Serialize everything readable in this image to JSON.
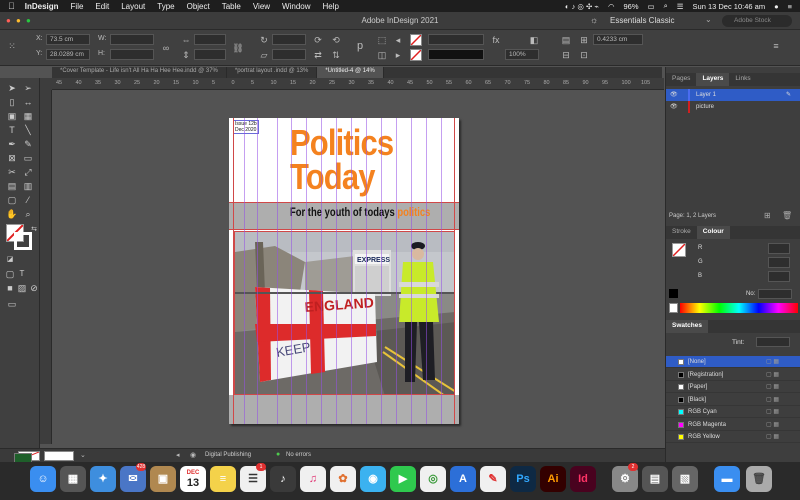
{
  "menubar": {
    "apple": "",
    "app_name": "InDesign",
    "items": [
      "File",
      "Edit",
      "Layout",
      "Type",
      "Object",
      "Table",
      "View",
      "Window",
      "Help"
    ],
    "battery": "96%",
    "datetime": "Sun 13 Dec  10:46 am"
  },
  "appbar": {
    "title": "Adobe InDesign 2021",
    "workspace": "Essentials Classic",
    "search_placeholder": "Adobe Stock"
  },
  "control": {
    "x_label": "X:",
    "x_value": "73.5 cm",
    "y_label": "Y:",
    "y_value": "28.0289 cm",
    "w_label": "W:",
    "h_label": "H:",
    "scale_x": "100%",
    "stroke_weight": "0.4233 cm",
    "zoom_pct": "100%"
  },
  "tabs": [
    "*Cover Template - Life isn't All Ha Ha Hee Hee.indd @ 37%",
    "*portrat layout .indd @ 13%",
    "*Untitled-4 @ 14%"
  ],
  "ruler": {
    "h_ticks": [
      "45",
      "40",
      "35",
      "30",
      "25",
      "20",
      "15",
      "10",
      "5",
      "0",
      "5",
      "10",
      "15",
      "20",
      "25",
      "30",
      "35",
      "40",
      "45",
      "50",
      "55",
      "60",
      "65",
      "70",
      "75",
      "80",
      "85",
      "90",
      "95",
      "100",
      "105"
    ]
  },
  "page": {
    "issue_line1": "Issue 12b",
    "issue_line2": "Dec 2020",
    "title_line1": "Politics",
    "title_line2": "Today",
    "tagline_main": "For the youth of todays ",
    "tagline_highlight": "politics",
    "photo_banner": "ENGLAND",
    "photo_banner2": "KEEP",
    "photo_sign": "EXPRESS"
  },
  "status": {
    "preflight_profile": "Digital Publishing",
    "errors": "No errors"
  },
  "layers_panel": {
    "tabs": [
      "Pages",
      "Layers",
      "Links"
    ],
    "layers": [
      {
        "name": "Layer 1",
        "color": "#4a6cf0"
      },
      {
        "name": "picture",
        "color": "#d02020"
      }
    ],
    "footer": "Page: 1, 2 Layers"
  },
  "colour_panel": {
    "tabs": [
      "Stroke",
      "Colour"
    ],
    "channels": [
      "R",
      "G",
      "B"
    ],
    "no_label": "No:"
  },
  "swatches_panel": {
    "tab": "Swatches",
    "tint_label": "Tint:",
    "items": [
      {
        "name": "[None]",
        "color": "#ffffff",
        "selected": true
      },
      {
        "name": "[Registration]",
        "color": "#000000"
      },
      {
        "name": "[Paper]",
        "color": "#ffffff"
      },
      {
        "name": "[Black]",
        "color": "#000000"
      },
      {
        "name": "RGB Cyan",
        "color": "#00ffff"
      },
      {
        "name": "RGB Magenta",
        "color": "#ff00ff"
      },
      {
        "name": "RGB Yellow",
        "color": "#ffff00"
      }
    ]
  },
  "dock": {
    "calendar_month": "DEC",
    "calendar_day": "13",
    "mail_badge": "428",
    "reminders_badge": "1",
    "settings_badge": "2",
    "ps": "Ps",
    "ai": "Ai",
    "id": "Id"
  },
  "colors": {
    "accent_orange": "#f4821f",
    "guide_purple": "#9650e6",
    "menubar_bg": "#1e1e1e",
    "panel_bg": "#3e3e3e",
    "canvas_bg": "#535353"
  }
}
